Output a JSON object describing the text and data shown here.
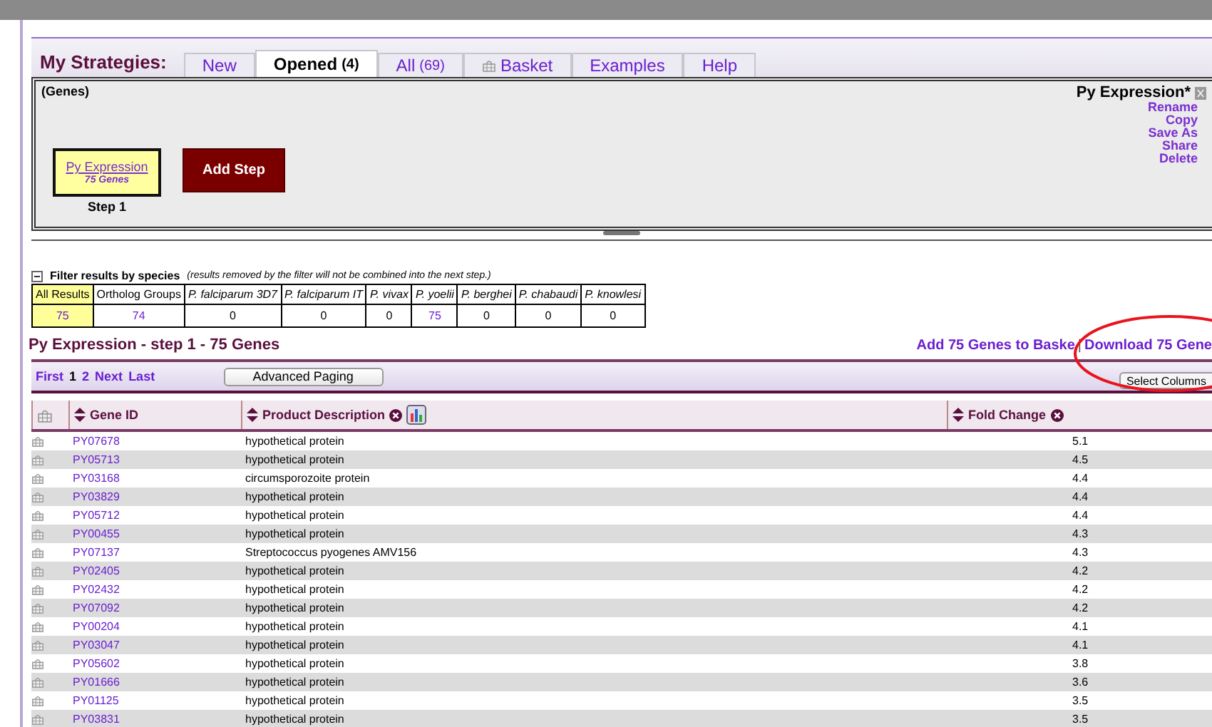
{
  "strategies": {
    "label": "My Strategies:",
    "tabs": [
      {
        "label": "New",
        "selected": false
      },
      {
        "label": "Opened",
        "count": "(4)",
        "selected": true
      },
      {
        "label": "All",
        "count": "(69)",
        "selected": false
      },
      {
        "label": "Basket",
        "kind": "basket",
        "selected": false
      },
      {
        "label": "Examples",
        "selected": false
      },
      {
        "label": "Help",
        "selected": false
      }
    ],
    "panel": {
      "type_label": "(Genes)",
      "step": {
        "name": "Py Expression",
        "count": "75 Genes",
        "label": "Step 1"
      },
      "add_step": "Add Step",
      "strategy_name": "Py Expression*",
      "actions": [
        "Rename",
        "Copy",
        "Save As",
        "Share",
        "Delete"
      ]
    }
  },
  "filter": {
    "title": "Filter results by species",
    "note": "(results removed by the filter will not be combined into the next step.)",
    "columns": [
      {
        "label": "All Results",
        "value": "75",
        "italic": false,
        "selected": true,
        "link": true
      },
      {
        "label": "Ortholog Groups",
        "value": "74",
        "italic": false,
        "selected": false,
        "link": true
      },
      {
        "label": "P. falciparum 3D7",
        "value": "0",
        "italic": true,
        "selected": false,
        "link": false
      },
      {
        "label": "P. falciparum IT",
        "value": "0",
        "italic": true,
        "selected": false,
        "link": false
      },
      {
        "label": "P. vivax",
        "value": "0",
        "italic": true,
        "selected": false,
        "link": false
      },
      {
        "label": "P. yoelii",
        "value": "75",
        "italic": true,
        "selected": false,
        "link": true
      },
      {
        "label": "P. berghei",
        "value": "0",
        "italic": true,
        "selected": false,
        "link": false
      },
      {
        "label": "P. chabaudi",
        "value": "0",
        "italic": true,
        "selected": false,
        "link": false
      },
      {
        "label": "P. knowlesi",
        "value": "0",
        "italic": true,
        "selected": false,
        "link": false
      }
    ]
  },
  "results": {
    "title": "Py Expression - step 1 - 75 Genes",
    "add_to_basket": "Add 75 Genes to Baske",
    "separator": "|",
    "download": "Download 75 Gene",
    "paging": [
      {
        "label": "First",
        "link": true
      },
      {
        "label": "1",
        "link": false
      },
      {
        "label": "2",
        "link": true
      },
      {
        "label": "Next",
        "link": true
      },
      {
        "label": "Last",
        "link": true
      }
    ],
    "advanced_paging": "Advanced Paging",
    "select_columns": "Select Columns",
    "columns": [
      "Gene ID",
      "Product Description",
      "Fold Change"
    ],
    "rows": [
      [
        "PY07678",
        "hypothetical protein",
        "5.1"
      ],
      [
        "PY05713",
        "hypothetical protein",
        "4.5"
      ],
      [
        "PY03168",
        "circumsporozoite protein",
        "4.4"
      ],
      [
        "PY03829",
        "hypothetical protein",
        "4.4"
      ],
      [
        "PY05712",
        "hypothetical protein",
        "4.4"
      ],
      [
        "PY00455",
        "hypothetical protein",
        "4.3"
      ],
      [
        "PY07137",
        "Streptococcus pyogenes AMV156",
        "4.3"
      ],
      [
        "PY02405",
        "hypothetical protein",
        "4.2"
      ],
      [
        "PY02432",
        "hypothetical protein",
        "4.2"
      ],
      [
        "PY07092",
        "hypothetical protein",
        "4.2"
      ],
      [
        "PY00204",
        "hypothetical protein",
        "4.1"
      ],
      [
        "PY03047",
        "hypothetical protein",
        "4.1"
      ],
      [
        "PY05602",
        "hypothetical protein",
        "3.8"
      ],
      [
        "PY01666",
        "hypothetical protein",
        "3.6"
      ],
      [
        "PY01125",
        "hypothetical protein",
        "3.5"
      ],
      [
        "PY03831",
        "hypothetical protein",
        "3.5"
      ]
    ]
  }
}
